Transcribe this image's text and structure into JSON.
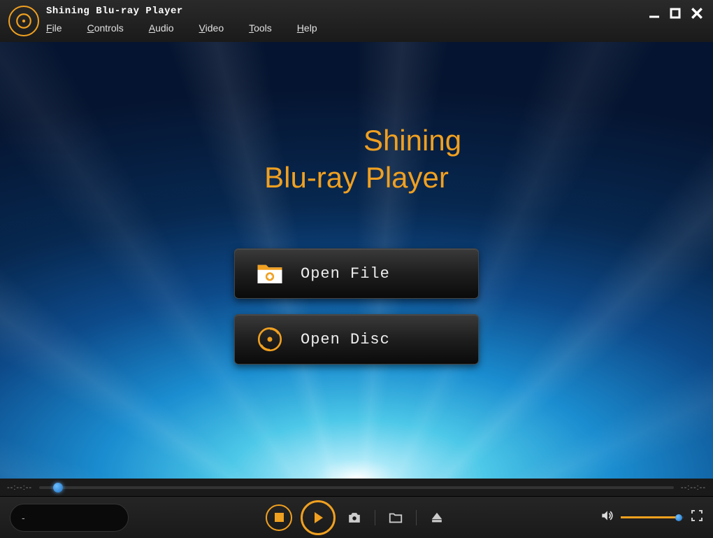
{
  "app_title": "Shining Blu-ray Player",
  "menus": {
    "file": "File",
    "controls": "Controls",
    "audio": "Audio",
    "video": "Video",
    "tools": "Tools",
    "help": "Help"
  },
  "brand": {
    "line1": "Shining",
    "line2": "Blu-ray Player"
  },
  "buttons": {
    "open_file": "Open File",
    "open_disc": "Open Disc"
  },
  "time": {
    "current": "--:--:--",
    "total": "--:--:--"
  },
  "status_text": "-",
  "colors": {
    "accent": "#f0a020"
  }
}
